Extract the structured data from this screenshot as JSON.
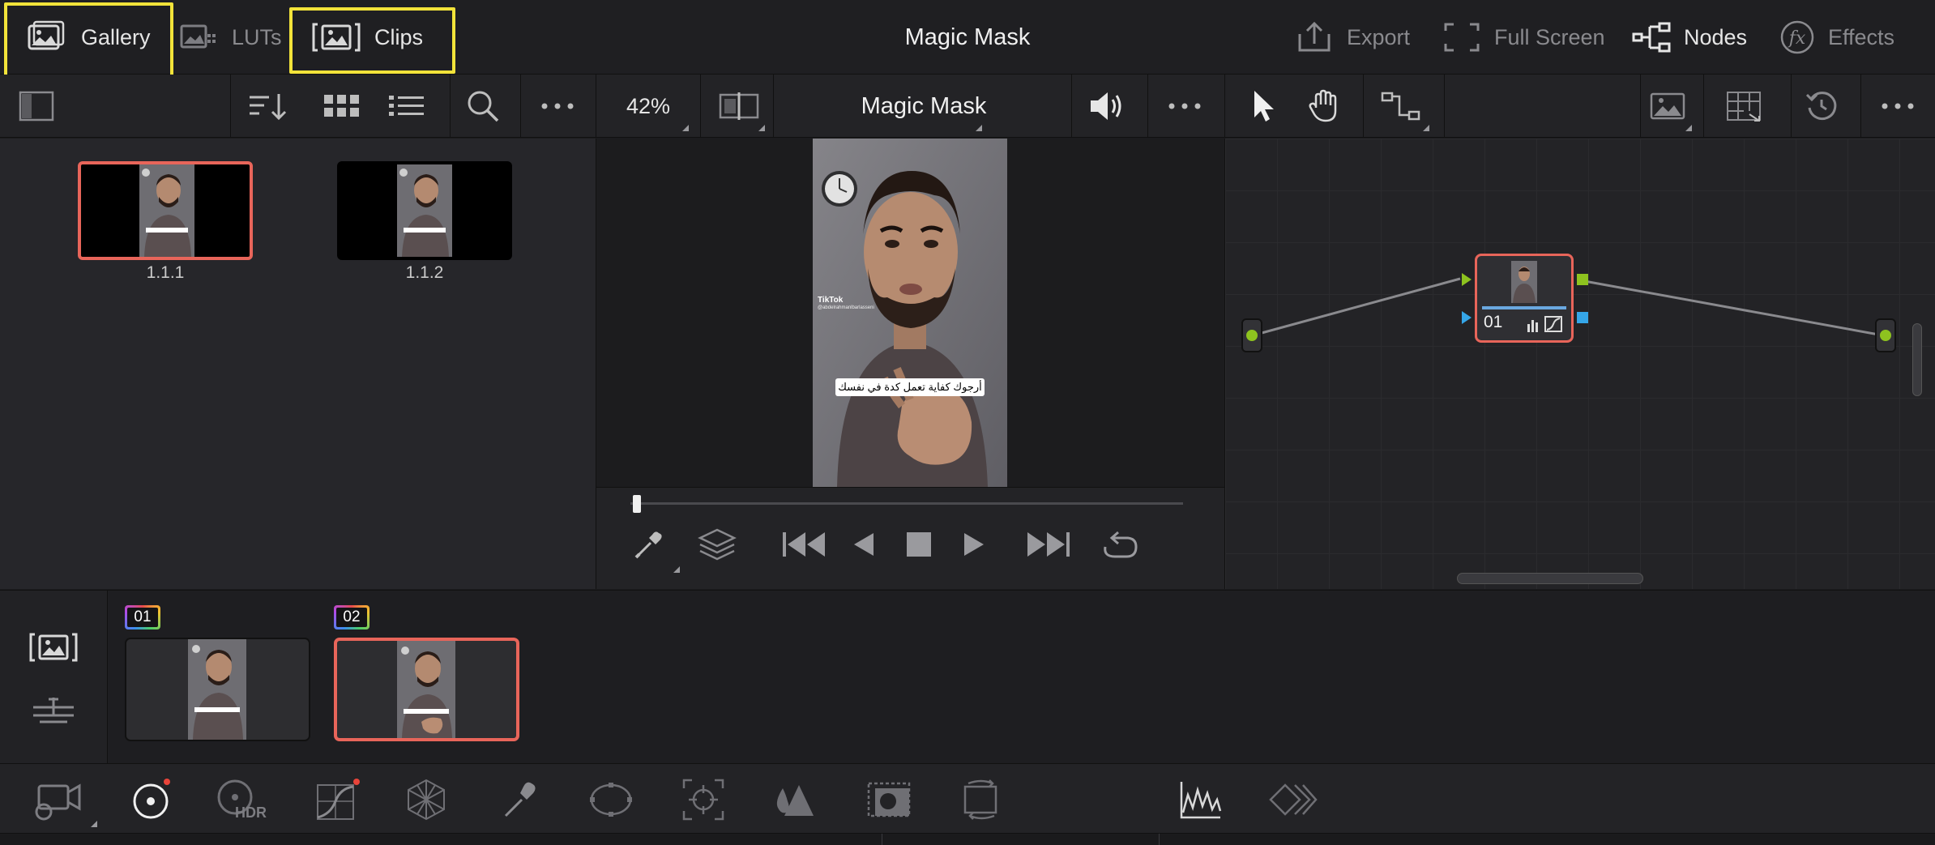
{
  "topbar": {
    "title": "Magic Mask",
    "left": [
      {
        "label": "Gallery",
        "icon": "gallery-icon",
        "active": true
      },
      {
        "label": "LUTs",
        "icon": "luts-icon",
        "active": false
      },
      {
        "label": "Clips",
        "icon": "clips-icon",
        "active": true
      }
    ],
    "right": [
      {
        "label": "Export",
        "icon": "export-icon"
      },
      {
        "label": "Full Screen",
        "icon": "fullscreen-icon"
      },
      {
        "label": "Nodes",
        "icon": "nodes-icon"
      },
      {
        "label": "Effects",
        "icon": "fx-icon"
      }
    ]
  },
  "toolbar": {
    "zoom": "42%",
    "viewer_title": "Magic Mask",
    "icons": [
      "sidebar-toggle-icon",
      "sort-icon",
      "grid-view-icon",
      "list-view-icon",
      "search-icon",
      "more-icon",
      "split-screen-icon",
      "speaker-icon",
      "more-icon",
      "pointer-icon",
      "hand-icon",
      "node-layout-icon",
      "image-icon",
      "lightbox-icon",
      "reset-icon",
      "more-icon"
    ]
  },
  "gallery": {
    "stills": [
      {
        "label": "1.1.1",
        "selected": true
      },
      {
        "label": "1.1.2",
        "selected": false
      }
    ]
  },
  "viewer": {
    "caption": "أرجوك كفاية تعمل كدة في نفسك",
    "watermark": "TikTok",
    "watermark_handle": "@abdelrahmanlbarlasseni",
    "playhead_fraction": 0.0
  },
  "nodes": {
    "node_label": "01"
  },
  "clips": {
    "items": [
      {
        "badge": "01",
        "selected": false
      },
      {
        "badge": "02",
        "selected": true
      }
    ]
  },
  "palette": {
    "hdr_label": "HDR",
    "icons": [
      "camera-raw-icon",
      "color-wheels-icon",
      "hdr-wheels-icon",
      "curves-icon",
      "color-warper-icon",
      "qualifier-icon",
      "window-icon",
      "tracker-icon",
      "blur-icon",
      "key-icon",
      "sizing-icon",
      "scopes-icon",
      "compare-icon"
    ]
  },
  "colors": {
    "highlight": "#f2e33a",
    "selection": "#e8655a",
    "node_green": "#8ec31f",
    "node_blue": "#35a6e8"
  }
}
